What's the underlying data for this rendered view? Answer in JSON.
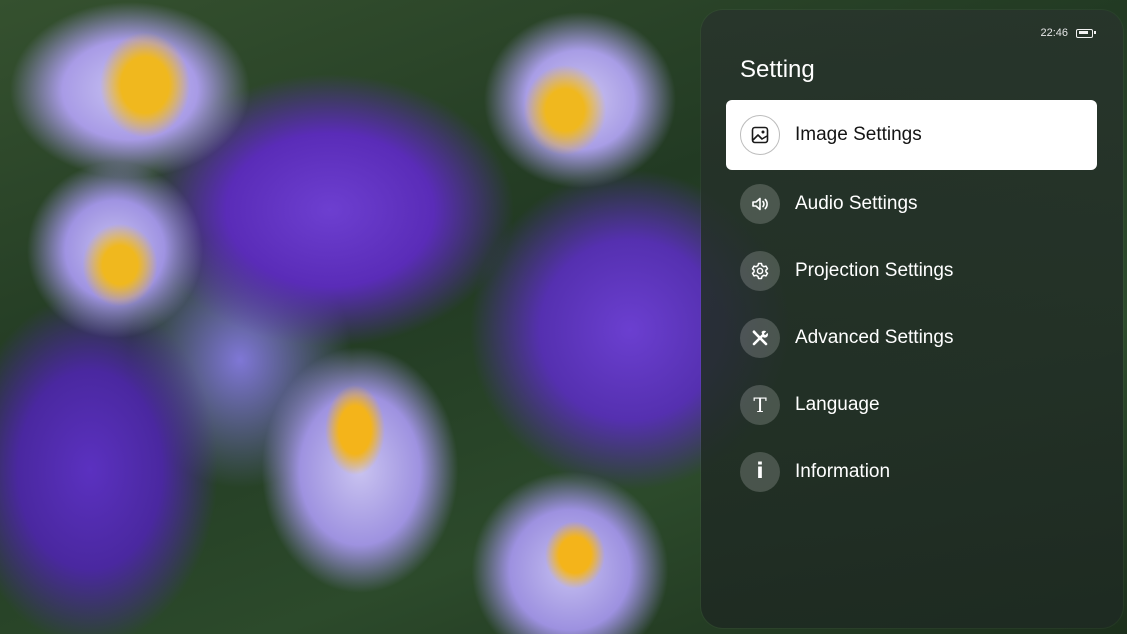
{
  "status_bar": {
    "time": "22:46",
    "battery_icon": "battery-icon"
  },
  "panel": {
    "title": "Setting",
    "items": [
      {
        "label": "Image Settings",
        "icon": "image-icon",
        "selected": true
      },
      {
        "label": "Audio Settings",
        "icon": "speaker-icon",
        "selected": false
      },
      {
        "label": "Projection Settings",
        "icon": "gear-icon",
        "selected": false
      },
      {
        "label": "Advanced Settings",
        "icon": "tools-icon",
        "selected": false
      },
      {
        "label": "Language",
        "icon": "text-icon",
        "selected": false
      },
      {
        "label": "Information",
        "icon": "info-icon",
        "selected": false
      }
    ]
  },
  "colors": {
    "panel_background": "#26342a",
    "selected_background": "#ffffff",
    "text": "#ffffff",
    "selected_text": "#141414"
  }
}
